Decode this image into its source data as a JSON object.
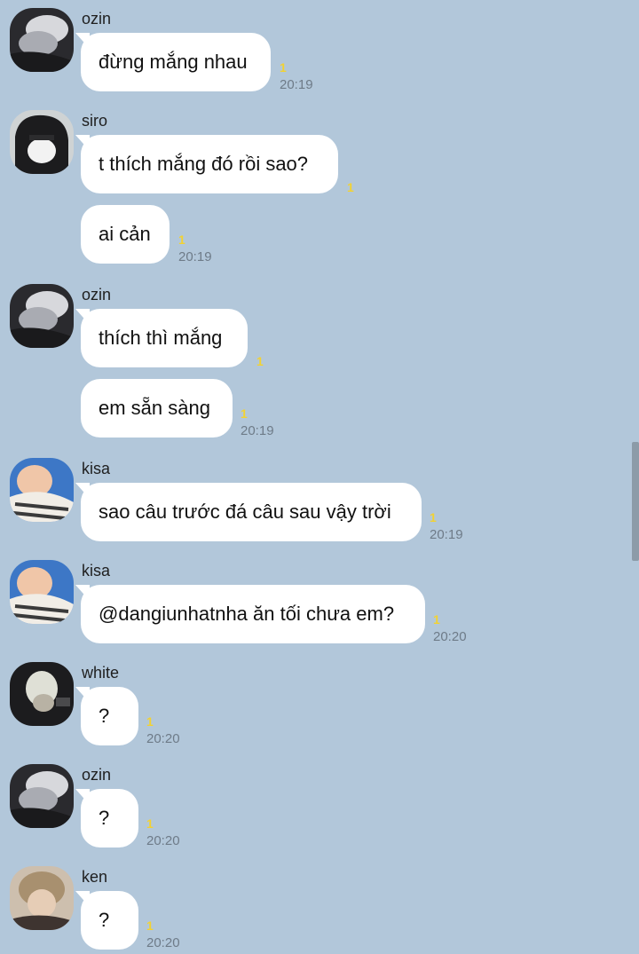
{
  "chat": {
    "groups": [
      {
        "sender": "ozin",
        "avatar_icon": "ozin-avatar-icon",
        "messages": [
          {
            "text": "đừng mắng nhau",
            "unread": "1",
            "time": "20:19"
          }
        ]
      },
      {
        "sender": "siro",
        "avatar_icon": "siro-avatar-icon",
        "messages": [
          {
            "text": "t thích mắng đó rồi sao?",
            "unread": "1",
            "time": ""
          },
          {
            "text": "ai cản",
            "unread": "1",
            "time": "20:19"
          }
        ]
      },
      {
        "sender": "ozin",
        "avatar_icon": "ozin-avatar-icon",
        "messages": [
          {
            "text": "thích thì mắng",
            "unread": "1",
            "time": ""
          },
          {
            "text": "em sẵn sàng",
            "unread": "1",
            "time": "20:19"
          }
        ]
      },
      {
        "sender": "kisa",
        "avatar_icon": "kisa-avatar-icon",
        "messages": [
          {
            "text": "sao câu trước đá câu sau vậy trời",
            "unread": "1",
            "time": "20:19"
          }
        ]
      },
      {
        "sender": "kisa",
        "avatar_icon": "kisa-avatar-icon",
        "messages": [
          {
            "text": "@dangiunhatnha ăn tối chưa em?",
            "unread": "1",
            "time": "20:20"
          }
        ]
      },
      {
        "sender": "white",
        "avatar_icon": "white-avatar-icon",
        "messages": [
          {
            "text": "?",
            "unread": "1",
            "time": "20:20"
          }
        ]
      },
      {
        "sender": "ozin",
        "avatar_icon": "ozin-avatar-icon",
        "messages": [
          {
            "text": "?",
            "unread": "1",
            "time": "20:20"
          }
        ]
      },
      {
        "sender": "ken",
        "avatar_icon": "ken-avatar-icon",
        "messages": [
          {
            "text": "?",
            "unread": "1",
            "time": "20:20"
          }
        ]
      }
    ]
  },
  "colors": {
    "background": "#b2c7da",
    "bubble": "#ffffff",
    "unread_count": "#f2d233",
    "time_text": "#6e7b88"
  }
}
